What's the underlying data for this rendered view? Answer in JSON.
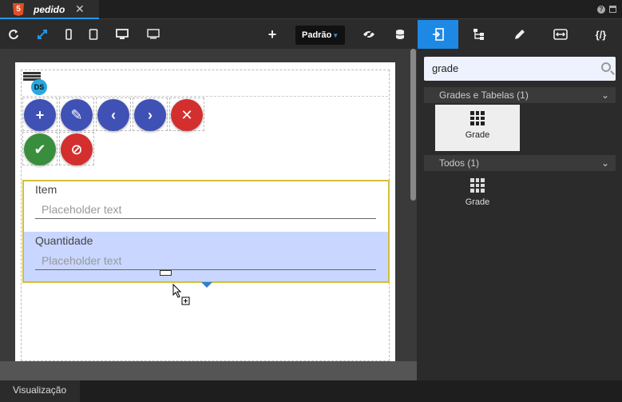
{
  "tab": {
    "title": "pedido",
    "close": "✕",
    "html5_badge": "5"
  },
  "window": {
    "help": "?"
  },
  "toolbar": {
    "icons": [
      "refresh-icon",
      "expand-icon",
      "phone-icon",
      "tablet-icon",
      "desktop-icon",
      "monitor-icon"
    ],
    "add": "+",
    "preset": "Padrão"
  },
  "canvas": {
    "ds_badge": "DS",
    "fabs": [
      {
        "glyph": "+",
        "color": "#3f51b5",
        "icon": "add-icon"
      },
      {
        "glyph": "✎",
        "color": "#3f51b5",
        "icon": "edit-icon"
      },
      {
        "glyph": "‹",
        "color": "#3f51b5",
        "icon": "chevron-left-icon"
      },
      {
        "glyph": "›",
        "color": "#3f51b5",
        "icon": "chevron-right-icon"
      },
      {
        "glyph": "✕",
        "color": "#d32f2f",
        "icon": "delete-icon"
      },
      {
        "glyph": "✔",
        "color": "#388e3c",
        "icon": "check-icon"
      },
      {
        "glyph": "⊘",
        "color": "#d32f2f",
        "icon": "cancel-icon"
      }
    ],
    "form": {
      "item_label": "Item",
      "item_placeholder": "Placeholder text",
      "qty_label": "Quantidade",
      "qty_placeholder": "Placeholder text"
    }
  },
  "statusbar": {
    "tab": "Visualização"
  },
  "rpanel": {
    "search_value": "grade",
    "categories": [
      {
        "label": "Grades e Tabelas (1)",
        "item": "Grade"
      },
      {
        "label": "Todos (1)",
        "item": "Grade"
      }
    ]
  },
  "colors": {
    "accent": "#1e88e5",
    "selection_border": "#d4bf3a",
    "highlight": "#c9d6ff"
  }
}
